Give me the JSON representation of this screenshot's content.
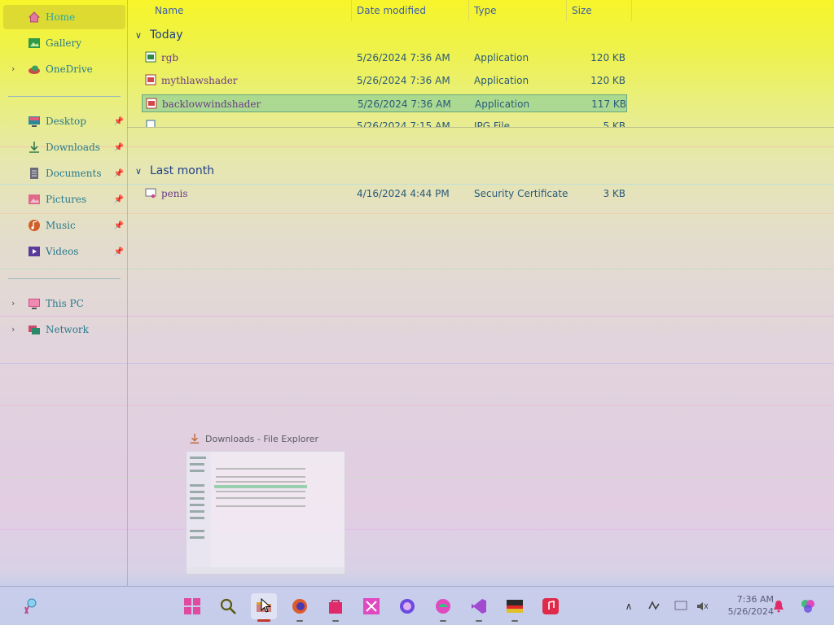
{
  "sidebar": {
    "items": [
      {
        "label": "Home",
        "icon": "home-icon"
      },
      {
        "label": "Gallery",
        "icon": "gallery-icon"
      },
      {
        "label": "OneDrive",
        "icon": "cloud-icon"
      },
      {
        "label": "Desktop",
        "icon": "desktop-icon"
      },
      {
        "label": "Downloads",
        "icon": "download-icon"
      },
      {
        "label": "Documents",
        "icon": "document-icon"
      },
      {
        "label": "Pictures",
        "icon": "pictures-icon"
      },
      {
        "label": "Music",
        "icon": "music-icon"
      },
      {
        "label": "Videos",
        "icon": "video-icon"
      },
      {
        "label": "This PC",
        "icon": "computer-icon"
      },
      {
        "label": "Network",
        "icon": "network-icon"
      }
    ]
  },
  "columns": {
    "name": "Name",
    "date": "Date modified",
    "type": "Type",
    "size": "Size"
  },
  "groups": {
    "today": "Today",
    "last_month": "Last month"
  },
  "files": {
    "today": [
      {
        "name": "rgb",
        "date": "5/26/2024 7:36 AM",
        "type": "Application",
        "size": "120 KB"
      },
      {
        "name": "mythlawshader",
        "date": "5/26/2024 7:36 AM",
        "type": "Application",
        "size": "120 KB"
      },
      {
        "name": "backlowwindshader",
        "date": "5/26/2024 7:36 AM",
        "type": "Application",
        "size": "117 KB"
      },
      {
        "name": "",
        "date": "5/26/2024 7:15 AM",
        "type": "JPG File",
        "size": "5 KB"
      }
    ],
    "last_month": [
      {
        "name": "penis",
        "date": "4/16/2024 4:44 PM",
        "type": "Security Certificate",
        "size": "3 KB"
      }
    ]
  },
  "preview": {
    "title": "Downloads - File Explorer"
  },
  "taskbar": {
    "clock_time": "7:36 AM",
    "clock_date": "5/26/2024"
  },
  "colors": {
    "selection": "#78c8a0",
    "sidebar_selection": "#d6d232",
    "text_link": "#2a7a8c",
    "accent_red": "#c0392b"
  }
}
